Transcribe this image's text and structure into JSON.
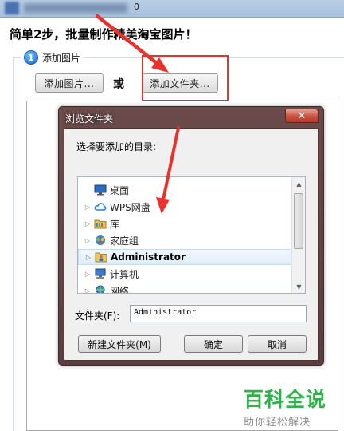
{
  "window": {
    "title_fragment": "0"
  },
  "app": {
    "heading": "简单2步，批量制作精美淘宝图片！",
    "step1": {
      "number": "1",
      "label": "添加图片"
    },
    "add_image_button": "添加图片...",
    "or_text": "或",
    "add_folder_button": "添加文件夹..."
  },
  "dialog": {
    "title": "浏览文件夹",
    "close_symbol": "✕",
    "instruction": "选择要添加的目录:",
    "tree": [
      {
        "label": "桌面",
        "icon": "desktop-icon",
        "expandable": false,
        "selected": false
      },
      {
        "label": "WPS网盘",
        "icon": "cloud-icon",
        "expandable": true,
        "selected": false
      },
      {
        "label": "库",
        "icon": "library-icon",
        "expandable": true,
        "selected": false
      },
      {
        "label": "家庭组",
        "icon": "homegroup-icon",
        "expandable": true,
        "selected": false
      },
      {
        "label": "Administrator",
        "icon": "user-folder-icon",
        "expandable": true,
        "selected": true
      },
      {
        "label": "计算机",
        "icon": "computer-icon",
        "expandable": true,
        "selected": false
      },
      {
        "label": "网络",
        "icon": "network-icon",
        "expandable": true,
        "selected": false
      }
    ],
    "folder_label": "文件夹(F):",
    "folder_value": "Administrator",
    "new_folder_button": "新建文件夹(M)",
    "ok_button": "确定",
    "cancel_button": "取消"
  },
  "watermark": {
    "main": "百科全说",
    "sub": "助你轻松解决"
  },
  "colors": {
    "annotation_red": "#e8322d",
    "watermark_green": "#2fb24a",
    "dialog_frame": "#5f4244"
  }
}
